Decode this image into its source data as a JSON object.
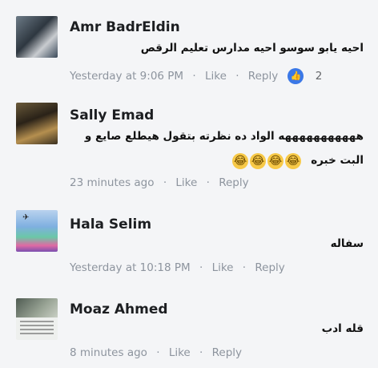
{
  "comments": [
    {
      "name": "Amr BadrEldin",
      "text": "احيه يابو سوسو احيه مدارس تعليم الرقص",
      "time": "Yesterday at 9:06 PM",
      "like": "Like",
      "reply": "Reply",
      "reaction_icon": "thumbs-up-icon",
      "reaction_count": "2"
    },
    {
      "name": "Sally Emad",
      "text_line1": "هههههههههههه الواد ده نظرته بتقول هيطلع صايع و",
      "text_line2": "البت خبره",
      "emoji_glyph": "😂",
      "time": "23 minutes ago",
      "like": "Like",
      "reply": "Reply"
    },
    {
      "name": "Hala Selim",
      "text": "سفاله",
      "time": "Yesterday at 10:18 PM",
      "like": "Like",
      "reply": "Reply"
    },
    {
      "name": "Moaz Ahmed",
      "text": "قله ادب",
      "time": "8 minutes ago",
      "like": "Like",
      "reply": "Reply"
    }
  ],
  "colors": {
    "background": "#f4f5f7",
    "meta": "#8d949e",
    "accent": "#3b78e7"
  }
}
